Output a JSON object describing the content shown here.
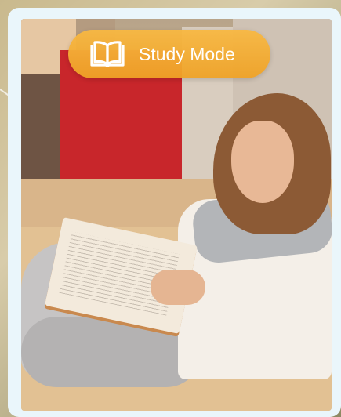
{
  "badge": {
    "label": "Study Mode",
    "icon": "open-book-icon",
    "color": "#f4ad35"
  },
  "photo": {
    "subject": "woman-reading-book-photo"
  }
}
